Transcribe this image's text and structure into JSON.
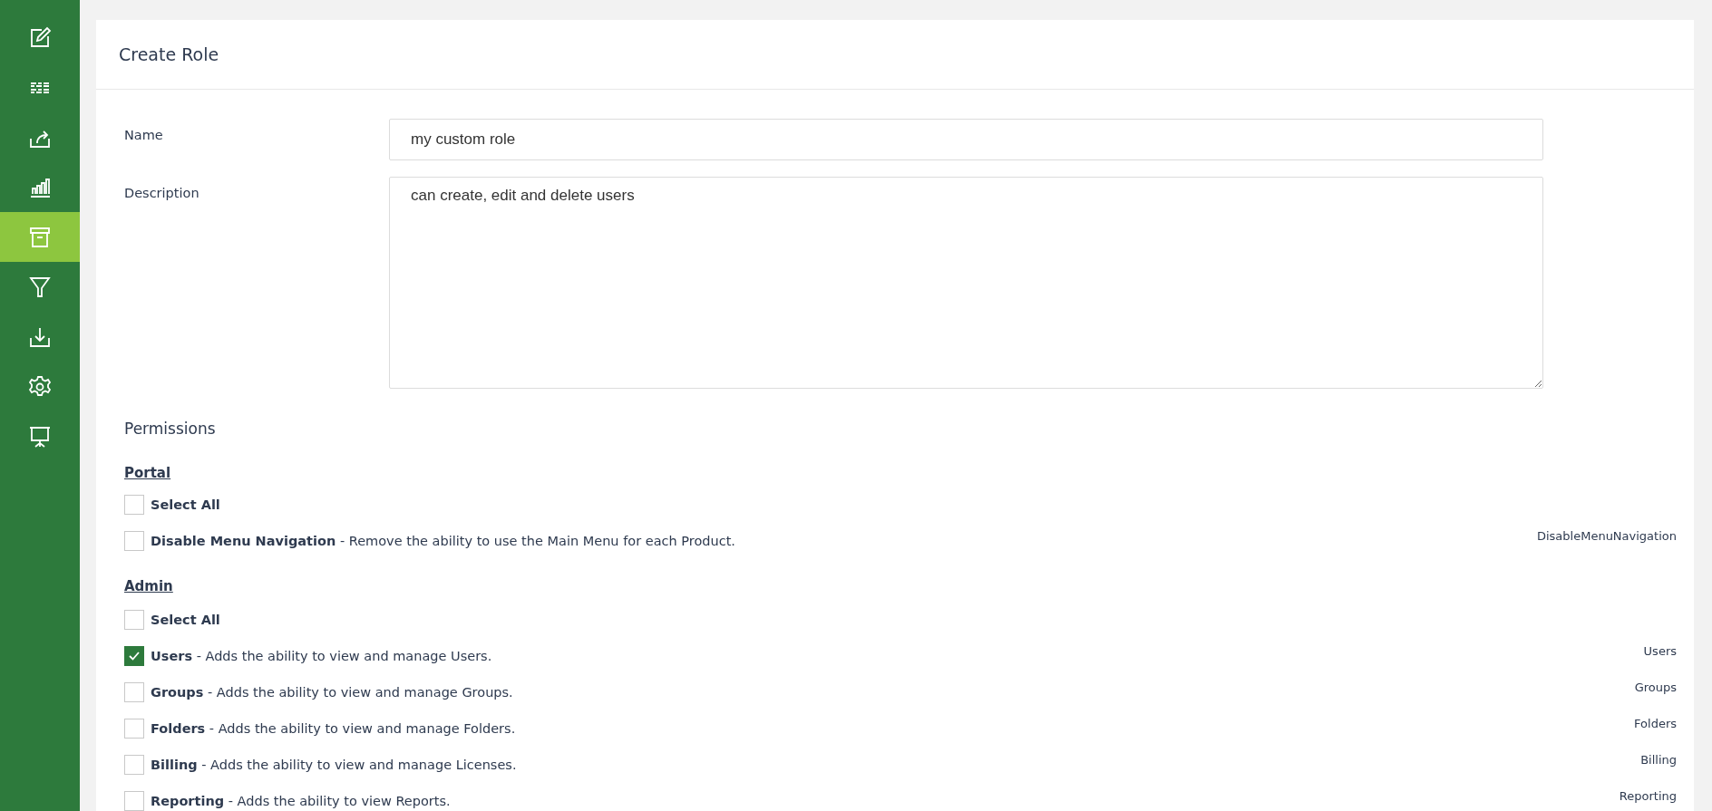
{
  "sidebar": {
    "items": [
      {
        "selected": false
      },
      {
        "selected": false
      },
      {
        "selected": false
      },
      {
        "selected": false
      },
      {
        "selected": true
      },
      {
        "selected": false
      },
      {
        "selected": false
      },
      {
        "selected": false
      },
      {
        "selected": false
      }
    ]
  },
  "page": {
    "title": "Create Role"
  },
  "form": {
    "fields": [
      {
        "kind": "input",
        "label": "Name",
        "value": "my custom role"
      },
      {
        "kind": "textarea",
        "label": "Description",
        "value": "can create, edit and delete users"
      }
    ]
  },
  "permissions": {
    "heading": "Permissions",
    "groups": [
      {
        "title": "Portal",
        "items": [
          {
            "text": "**Select All**",
            "checked": false
          },
          {
            "text": "**Disable Menu Navigation** - Remove the ability to use the Main Menu for each Product.",
            "code": "DisableMenuNavigation",
            "checked": false
          }
        ]
      },
      {
        "title": "Admin",
        "items": [
          {
            "text": "**Select All**",
            "checked": false
          },
          {
            "text": "**Users** - Adds the ability to view and manage Users.",
            "code": "Users",
            "checked": true
          },
          {
            "text": "**Groups** - Adds the ability to view and manage Groups.",
            "code": "Groups",
            "checked": false
          },
          {
            "text": "**Folders** - Adds the ability to view and manage Folders.",
            "code": "Folders",
            "checked": false
          },
          {
            "text": "**Billing** - Adds the ability to view and manage Licenses.",
            "code": "Billing",
            "checked": false
          },
          {
            "text": "**Reporting** - Adds the ability to view Reports.",
            "code": "Reporting",
            "checked": false
          }
        ]
      }
    ]
  }
}
